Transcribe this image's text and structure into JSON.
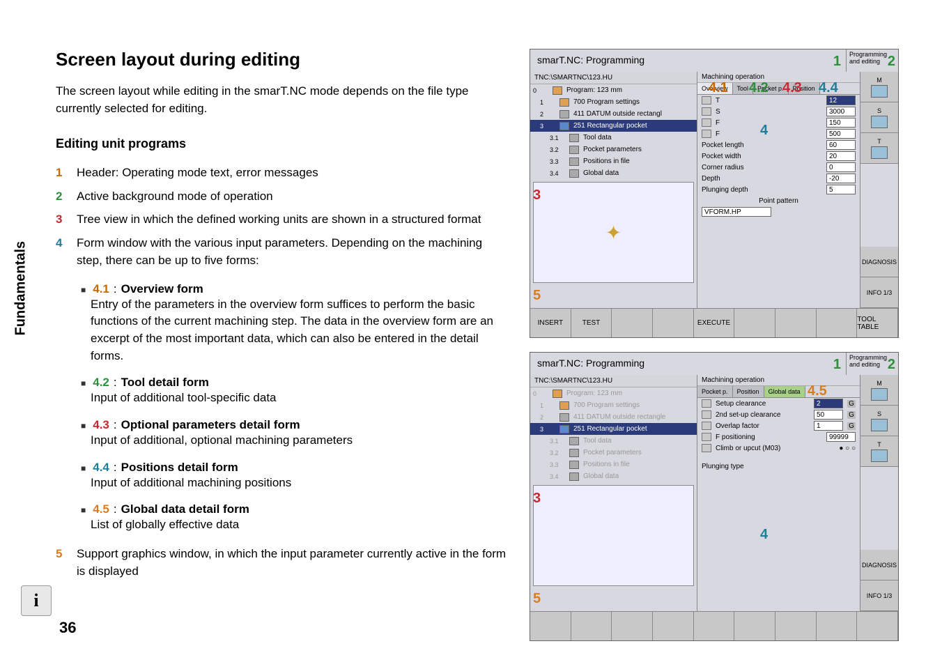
{
  "sidebar_label": "Fundamentals",
  "page_number": "36",
  "heading": "Screen layout during editing",
  "intro": "The screen layout while editing in the smarT.NC mode depends on the file type currently selected for editing.",
  "sub_heading": "Editing unit programs",
  "items": [
    {
      "n": "1",
      "cls": "n1",
      "text": "Header: Operating mode text, error messages"
    },
    {
      "n": "2",
      "cls": "n2",
      "text": "Active background mode of operation"
    },
    {
      "n": "3",
      "cls": "n3",
      "text": "Tree view in which the defined working units are shown in a structured format"
    },
    {
      "n": "4",
      "cls": "n4",
      "text": "Form window with the various input parameters. Depending on the machining step, there can be up to five forms:"
    }
  ],
  "sub_items": [
    {
      "num": "4.1",
      "cls": "n1",
      "title": "Overview form",
      "desc": "Entry of the parameters in the overview form suffices to perform the basic functions of the current machining step. The data in the overview form are an excerpt of the most important data, which can also be entered in the detail forms."
    },
    {
      "num": "4.2",
      "cls": "n2",
      "title": "Tool detail form",
      "desc": "Input of additional tool-specific data"
    },
    {
      "num": "4.3",
      "cls": "n3",
      "title": "Optional parameters detail form",
      "desc": "Input of additional, optional machining parameters"
    },
    {
      "num": "4.4",
      "cls": "n4",
      "title": "Positions detail form",
      "desc": "Input of additional machining positions"
    },
    {
      "num": "4.5",
      "cls": "n5",
      "title": "Global data detail form",
      "desc": "List of globally effective data"
    }
  ],
  "item5": {
    "n": "5",
    "cls": "n5",
    "text": "Support graphics window, in which the input parameter currently active in the form is displayed"
  },
  "ss1": {
    "title": "smarT.NC: Programming",
    "mode": "Programming and editing",
    "path": "TNC:\\SMARTNC\\123.HU",
    "form_header": "Machining operation",
    "tree": [
      {
        "lvl": "0",
        "ico": "orange",
        "txt": "Program: 123 mm",
        "sel": false,
        "sub": "0"
      },
      {
        "lvl": "1",
        "ico": "orange",
        "txt": "700 Program settings",
        "sel": false,
        "sub": "1"
      },
      {
        "lvl": "1",
        "ico": "",
        "txt": "411 DATUM outside rectangl",
        "sel": false,
        "sub": "2"
      },
      {
        "lvl": "1",
        "ico": "blue",
        "txt": "251 Rectangular pocket",
        "sel": true,
        "sub": "3"
      },
      {
        "lvl": "2",
        "ico": "",
        "txt": "Tool data",
        "sel": false,
        "sub": "3.1"
      },
      {
        "lvl": "2",
        "ico": "",
        "txt": "Pocket parameters",
        "sel": false,
        "sub": "3.2"
      },
      {
        "lvl": "2",
        "ico": "",
        "txt": "Positions in file",
        "sel": false,
        "sub": "3.3"
      },
      {
        "lvl": "2",
        "ico": "",
        "txt": "Global data",
        "sel": false,
        "sub": "3.4"
      }
    ],
    "tabs": [
      "Overview",
      "Tool",
      "Pocket p.",
      "Position"
    ],
    "rows": [
      {
        "label": "T",
        "val": "12",
        "ico": true,
        "sel": true
      },
      {
        "label": "S",
        "val": "3000",
        "ico": true
      },
      {
        "label": "F",
        "val": "150",
        "ico": true
      },
      {
        "label": "F",
        "val": "500",
        "ico": true
      },
      {
        "label": "Pocket length",
        "val": "60"
      },
      {
        "label": "Pocket width",
        "val": "20"
      },
      {
        "label": "Corner radius",
        "val": "0"
      },
      {
        "label": "Depth",
        "val": "-20"
      },
      {
        "label": "Plunging depth",
        "val": "5"
      }
    ],
    "point_pattern": "Point pattern",
    "vform": "VFORM.HP",
    "right": [
      "M",
      "S",
      "T"
    ],
    "diag": "DIAGNOSIS",
    "info": "INFO 1/3",
    "bottom": [
      "INSERT",
      "TEST",
      "",
      "",
      "EXECUTE",
      "",
      "",
      "",
      "TOOL TABLE"
    ],
    "marks": {
      "m1": "1",
      "m2": "2",
      "m3": "3",
      "m4": "4",
      "m5": "5",
      "m41": "4.1",
      "m42": "4.2",
      "m43": "4.3",
      "m44": "4.4"
    }
  },
  "ss2": {
    "title": "smarT.NC: Programming",
    "mode": "Programming and editing",
    "path": "TNC:\\SMARTNC\\123.HU",
    "form_header": "Machining operation",
    "tree": [
      {
        "lvl": "0",
        "ico": "orange",
        "txt": "Program: 123 mm",
        "sel": false,
        "sub": "0",
        "fade": true
      },
      {
        "lvl": "1",
        "ico": "orange",
        "txt": "700 Program settings",
        "sel": false,
        "sub": "1",
        "fade": true
      },
      {
        "lvl": "1",
        "ico": "",
        "txt": "411 DATUM outside rectangle",
        "sel": false,
        "sub": "2",
        "fade": true
      },
      {
        "lvl": "1",
        "ico": "blue",
        "txt": "251 Rectangular pocket",
        "sel": true,
        "sub": "3"
      },
      {
        "lvl": "2",
        "ico": "",
        "txt": "Tool data",
        "sel": false,
        "sub": "3.1",
        "fade": true
      },
      {
        "lvl": "2",
        "ico": "",
        "txt": "Pocket parameters",
        "sel": false,
        "sub": "3.2",
        "fade": true
      },
      {
        "lvl": "2",
        "ico": "",
        "txt": "Positions in file",
        "sel": false,
        "sub": "3.3",
        "fade": true
      },
      {
        "lvl": "2",
        "ico": "",
        "txt": "Global data",
        "sel": false,
        "sub": "3.4",
        "fade": true
      }
    ],
    "tabs": [
      "Pocket p.",
      "Position",
      "Global data"
    ],
    "active_tab": "Global data",
    "rows": [
      {
        "label": "Setup clearance",
        "val": "2",
        "g": "G",
        "sel": true,
        "ico": true
      },
      {
        "label": "2nd set-up clearance",
        "val": "50",
        "g": "G",
        "ico": true
      },
      {
        "label": "Overlap factor",
        "val": "1",
        "g": "G",
        "ico": true
      },
      {
        "label": "F positioning",
        "val": "99999",
        "ico": true
      },
      {
        "label": "Climb or upcut (M03)",
        "val": "",
        "ico": true,
        "radio": true
      }
    ],
    "plunge": "Plunging type",
    "right": [
      "M",
      "S",
      "T"
    ],
    "diag": "DIAGNOSIS",
    "info": "INFO 1/3",
    "marks": {
      "m1": "1",
      "m2": "2",
      "m3": "3",
      "m4": "4",
      "m5": "5",
      "m45": "4.5"
    }
  }
}
